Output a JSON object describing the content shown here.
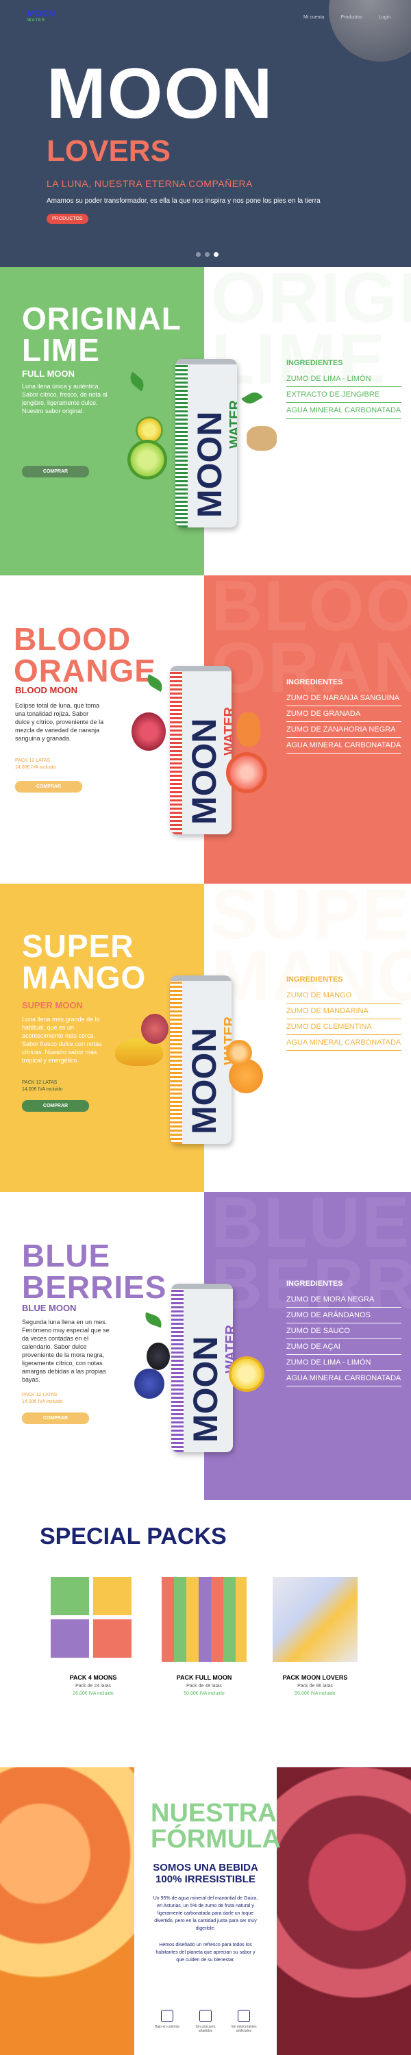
{
  "header": {
    "logo_top": "MOON",
    "logo_mid": "WATER",
    "nav": [
      "Mi cuenta",
      "Productos",
      "Login"
    ]
  },
  "hero": {
    "title": "MOON",
    "subtitle": "LOVERS",
    "tagline": "LA LUNA, NUESTRA ETERNA COMPAÑERA",
    "description": "Amamos su poder transformador, es ella la que nos inspira y nos pone los pies en la tierra",
    "button": "PRODUCTOS"
  },
  "products": [
    {
      "title_1": "ORIGINAL",
      "title_2": "LIME",
      "name": "FULL MOON",
      "description": "Luna llena única y auténtica. Sabor cítrico, fresco, de nota al jengibre, ligeramente dulce. Nuestro sabor original.",
      "price": "",
      "button": "COMPRAR",
      "ingredients_title": "INGREDIENTES",
      "ingredients": [
        "ZUMO DE LIMA - LIMÓN",
        "EXTRACTO DE JENGIBRE",
        "AGUA MINERAL CARBONATADA"
      ],
      "bg_word": "ORIGINAL LIME",
      "can_word": "WATER"
    },
    {
      "title_1": "BLOOD",
      "title_2": "ORANGE",
      "name": "BLOOD MOON",
      "description": "Eclipse total de luna, que toma una tonalidad rojiza. Sabor dulce y cítrico, proveniente de la mezcla de variedad de naranja sanguina y granada.",
      "price": "PACK 12 LATAS\n14,00€ IVA incluido",
      "button": "COMPRAR",
      "ingredients_title": "INGREDIENTES",
      "ingredients": [
        "ZUMO DE NARANJA SANGUINA",
        "ZUMO DE GRANADA",
        "ZUMO DE ZANAHORIA NEGRA",
        "AGUA MINERAL CARBONATADA"
      ],
      "bg_word": "BLOOD ORANGE",
      "can_word": "WATER"
    },
    {
      "title_1": "SUPER",
      "title_2": "MANGO",
      "name": "SUPER MOON",
      "description": "Luna llena más grande de lo habitual, que es un acontecimiento más cerca. Sabor fresco dulce con notas cítricas. Nuestro sabor más tropical y energético.",
      "price": "PACK 12 LATAS\n14,00€ IVA incluido",
      "button": "COMPRAR",
      "ingredients_title": "INGREDIENTES",
      "ingredients": [
        "ZUMO DE MANGO",
        "ZUMO DE MANDARINA",
        "ZUMO DE CLEMENTINA",
        "AGUA MINERAL CARBONATADA"
      ],
      "bg_word": "SUPER MANGO",
      "can_word": "WATER"
    },
    {
      "title_1": "BLUE",
      "title_2": "BERRIES",
      "name": "BLUE MOON",
      "description": "Segunda luna llena en un mes. Fenómeno muy especial que se da veces contadas en el calendario. Sabor dulce proveniente de la mora negra, ligeramente cítrico, con notas amargas debidas a las propias bayas.",
      "price": "PACK 12 LATAS\n14,00€ IVA incluido",
      "button": "COMPRAR",
      "ingredients_title": "INGREDIENTES",
      "ingredients": [
        "ZUMO DE MORA NEGRA",
        "ZUMO DE ARÁNDANOS",
        "ZUMO DE SAUCO",
        "ZUMO DE AÇAI",
        "ZUMO DE LIMA - LIMÓN",
        "AGUA MINERAL CARBONATADA"
      ],
      "bg_word": "BLUE BERRIES",
      "can_word": "WATER"
    }
  ],
  "packs": {
    "title": "SPECIAL PACKS",
    "items": [
      {
        "name": "PACK 4 MOONS",
        "qty": "Pack de 24 latas",
        "price": "26,00€ IVA incluido"
      },
      {
        "name": "PACK FULL MOON",
        "qty": "Pack de 48 latas",
        "price": "50,00€ IVA incluido"
      },
      {
        "name": "PACK MOON LOVERS",
        "qty": "Pack de 96 latas",
        "price": "95,00€ IVA incluido"
      }
    ]
  },
  "formula": {
    "title_1": "NUESTRA",
    "title_2": "FÓRMULA",
    "subtitle": "SOMOS UNA BEBIDA 100% IRRESISTIBLE",
    "p1": "Un 95% de agua mineral del manantial de Gaiza, en Asturias, un 5% de zumo de fruta natural y ligeramente carbonatada para darle un toque divertido, pero en la cantidad justa para ser muy digerible.",
    "p2": "Hemos diseñado un refresco para todos los habitantes del planeta que aprecian su sabor y que cuiden de su bienestar.",
    "icons": [
      "Bajo en calorías",
      "Sin azúcares añadidos",
      "Sin edulcorantes artificiales"
    ]
  }
}
